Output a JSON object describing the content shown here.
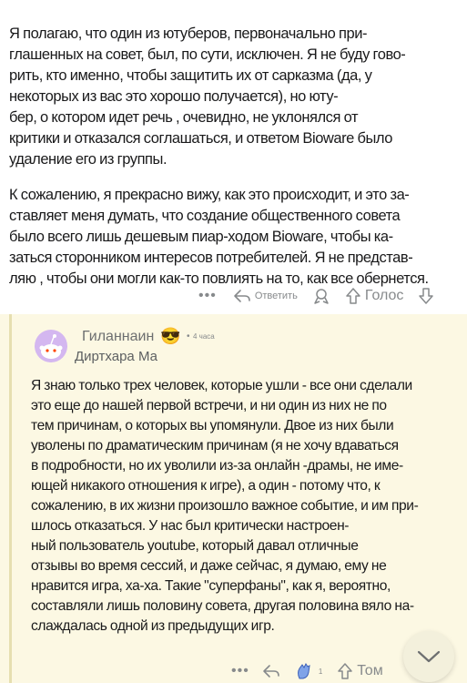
{
  "comment1": {
    "paragraphs": [
      "Я полагаю, что один из ютуберов, первоначально при-\n глашенных на совет, был, по сути, исключен. Я не буду гово-\n рить, кто именно, чтобы защитить их от сарказма (да, у\nнекоторых из вас это хорошо получается), но юту-\n бер, о котором идет речь , очевидно, не уклонялся от\n критики и отказался соглашаться, и ответом Bioware было\nудаление  его  из  группы.",
      "К сожалению, я прекрасно вижу, как это происходит, и это за-\nставляет меня думать, что создание общественного совета\n было всего лишь дешевым пиар-ходом Bioware, чтобы ка-\n заться сторонником интересов потребителей. Я не представ-\n ляю , чтобы они могли как-то повлиять на то, как все обернется."
    ],
    "actions": {
      "more": "•••",
      "reply_label": "Ответить",
      "vote_label": "Голос"
    }
  },
  "comment2": {
    "username": "Гиланнаин",
    "emoji": "😎",
    "dot": "•",
    "time": "4 часа",
    "flair": "Диртхара Ма",
    "text": "Я знаю только трех человек, которые ушли - все они сделали\n это еще до нашей первой встречи, и ни один из них не по\n тем причинам, о которых вы упомянули. Двое из них были\nуволены по драматическим причинам (я не хочу вдаваться\n в подробности, но их уволили из-за онлайн -драмы, не име-\nющей никакого отношения к игре), а один - потому что, к\n сожалению, в их жизни произошло важное событие, и им при-\nшлось отказаться. У нас был критически настроен-\nный пользователь youtube, который давал отличные\n отзывы во время сессий, и даже сейчас, я думаю, ему не\nнравится игра, ха-ха. Такие \"суперфаны\", как я, вероятно,\nсоставляли лишь половину совета, другая половина вяло на-\n слаждалась одной из предыдущих игр.",
    "actions": {
      "more": "•••",
      "award_count": "1",
      "vote_label": "Том"
    }
  },
  "colors": {
    "background": "#ffffff",
    "highlight_bg": "#fcf8e3",
    "meta_gray": "#878a8c",
    "avatar_bg": "#d4b7f0"
  }
}
